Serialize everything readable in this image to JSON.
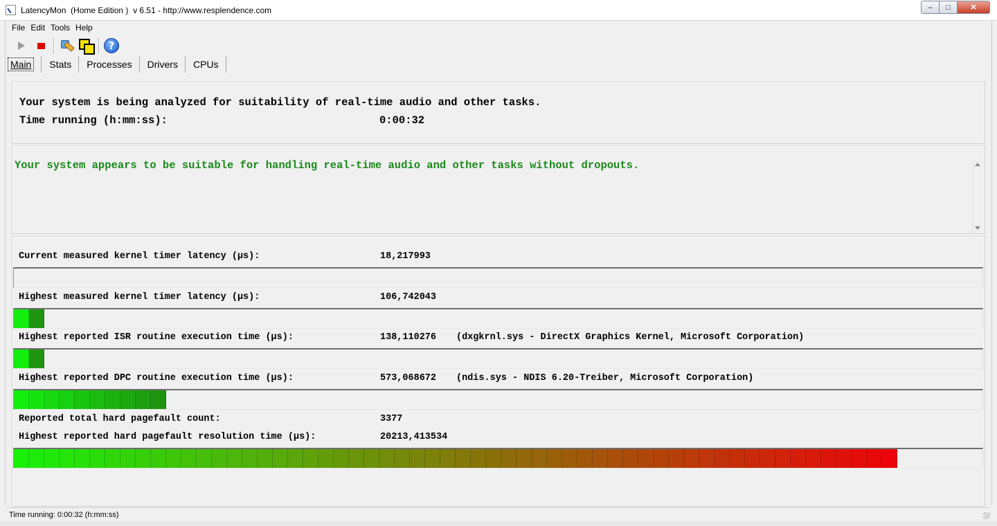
{
  "window": {
    "title": "LatencyMon  (Home Edition )  v 6.51 - http://www.resplendence.com",
    "minimize_label": "–",
    "maximize_label": "□",
    "close_label": "✕"
  },
  "menu": [
    "File",
    "Edit",
    "Tools",
    "Help"
  ],
  "toolbar": {
    "icons": [
      "play-icon",
      "stop-icon",
      "settings-icon",
      "windows-icon",
      "help-icon"
    ],
    "help_glyph": "?"
  },
  "tabs": [
    "Main",
    "Stats",
    "Processes",
    "Drivers",
    "CPUs"
  ],
  "main": {
    "analyzing_text": "Your system is being analyzed for suitability of real-time audio and other tasks.",
    "time_running_label": "Time running (h:mm:ss):",
    "time_running_value": "0:00:32",
    "verdict": "Your system appears to be suitable for handling real-time audio and other tasks without dropouts.",
    "verdict_color": "#1a8a1a",
    "metrics": [
      {
        "label": "Current measured kernel timer latency (µs):",
        "value": "18,217993",
        "detail": "",
        "bar_segments": 0
      },
      {
        "label": "Highest measured kernel timer latency (µs):",
        "value": "106,742043",
        "detail": "",
        "bar_segments": 2
      },
      {
        "label": "Highest reported ISR routine execution time (µs):",
        "value": "138,110276",
        "detail": "(dxgkrnl.sys - DirectX Graphics Kernel, Microsoft Corporation)",
        "bar_segments": 2
      },
      {
        "label": "Highest reported DPC routine execution time (µs):",
        "value": "573,068672",
        "detail": "(ndis.sys - NDIS 6.20-Treiber, Microsoft Corporation)",
        "bar_segments": 10
      }
    ],
    "pagefault_count_label": "Reported total hard pagefault count:",
    "pagefault_count_value": "3377",
    "pagefault_time_label": "Highest reported hard pagefault resolution time (µs):",
    "pagefault_time_value": "20213,413534",
    "pagefault_bar_segments": 58
  },
  "status": "Time running: 0:00:32  (h:mm:ss)"
}
